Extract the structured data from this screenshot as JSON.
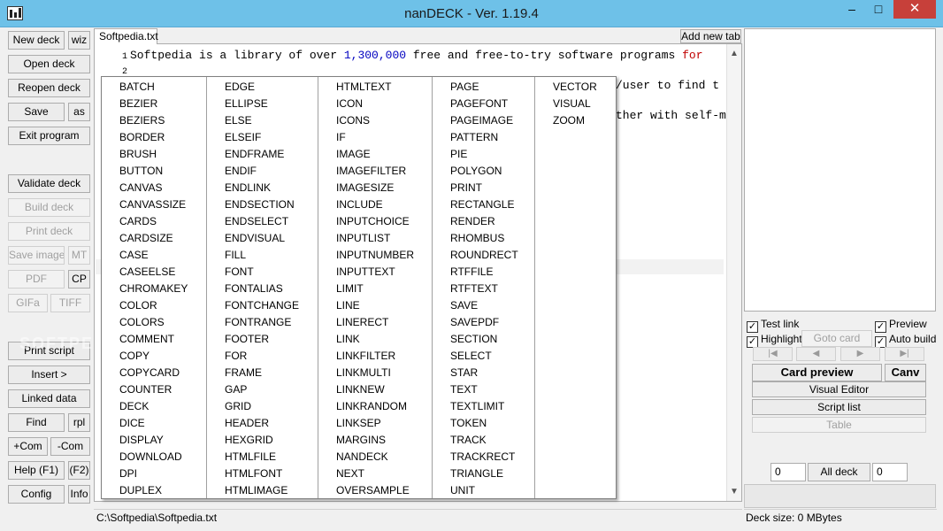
{
  "window": {
    "title": "nanDECK - Ver. 1.19.4"
  },
  "window_controls": {
    "minimize": "–",
    "maximize": "□",
    "close": "✕"
  },
  "left_panel": {
    "new_deck": "New deck",
    "wiz": "wiz",
    "open_deck": "Open deck",
    "reopen_deck": "Reopen deck",
    "save": "Save",
    "save_as": "as",
    "exit": "Exit program",
    "validate": "Validate deck",
    "build": "Build deck",
    "print_deck": "Print deck",
    "save_images": "Save images",
    "mt": "MT",
    "pdf": "PDF",
    "cp": "CP",
    "gifa": "GIFa",
    "tiff": "TIFF",
    "print_script": "Print script",
    "insert": "Insert >",
    "linked_data": "Linked data",
    "find": "Find",
    "rpl": "rpl",
    "plus_com": "+Com",
    "minus_com": "-Com",
    "help": "Help (F1)",
    "f2": "(F2)",
    "config": "Config",
    "info": "Info"
  },
  "editor": {
    "tab_label": "Softpedia.txt",
    "add_tab": "Add new tab",
    "lines": [
      {
        "num": "1",
        "text_a": "Softpedia is a library of over ",
        "num_text": "1,300,000",
        "text_b": " free and free-to-try software programs ",
        "red_text": "for"
      },
      {
        "num": "2",
        "text": ""
      }
    ],
    "partial_3": "/user to find t",
    "partial_4": "ther with self-m"
  },
  "autocomplete": {
    "columns": [
      [
        "BATCH",
        "BEZIER",
        "BEZIERS",
        "BORDER",
        "BRUSH",
        "BUTTON",
        "CANVAS",
        "CANVASSIZE",
        "CARDS",
        "CARDSIZE",
        "CASE",
        "CASEELSE",
        "CHROMAKEY",
        "COLOR",
        "COLORS",
        "COMMENT",
        "COPY",
        "COPYCARD",
        "COUNTER",
        "DECK",
        "DICE",
        "DISPLAY",
        "DOWNLOAD",
        "DPI",
        "DUPLEX"
      ],
      [
        "EDGE",
        "ELLIPSE",
        "ELSE",
        "ELSEIF",
        "ENDFRAME",
        "ENDIF",
        "ENDLINK",
        "ENDSECTION",
        "ENDSELECT",
        "ENDVISUAL",
        "FILL",
        "FONT",
        "FONTALIAS",
        "FONTCHANGE",
        "FONTRANGE",
        "FOOTER",
        "FOR",
        "FRAME",
        "GAP",
        "GRID",
        "HEADER",
        "HEXGRID",
        "HTMLFILE",
        "HTMLFONT",
        "HTMLIMAGE"
      ],
      [
        "HTMLTEXT",
        "ICON",
        "ICONS",
        "IF",
        "IMAGE",
        "IMAGEFILTER",
        "IMAGESIZE",
        "INCLUDE",
        "INPUTCHOICE",
        "INPUTLIST",
        "INPUTNUMBER",
        "INPUTTEXT",
        "LIMIT",
        "LINE",
        "LINERECT",
        "LINK",
        "LINKFILTER",
        "LINKMULTI",
        "LINKNEW",
        "LINKRANDOM",
        "LINKSEP",
        "MARGINS",
        "NANDECK",
        "NEXT",
        "OVERSAMPLE"
      ],
      [
        "PAGE",
        "PAGEFONT",
        "PAGEIMAGE",
        "PATTERN",
        "PIE",
        "POLYGON",
        "PRINT",
        "RECTANGLE",
        "RENDER",
        "RHOMBUS",
        "ROUNDRECT",
        "RTFFILE",
        "RTFTEXT",
        "SAVE",
        "SAVEPDF",
        "SECTION",
        "SELECT",
        "STAR",
        "TEXT",
        "TEXTLIMIT",
        "TOKEN",
        "TRACK",
        "TRACKRECT",
        "TRIANGLE",
        "UNIT"
      ],
      [
        "VECTOR",
        "VISUAL",
        "ZOOM"
      ]
    ]
  },
  "right_panel": {
    "test_link": "Test link",
    "preview": "Preview",
    "highlight": "Highlight",
    "goto_card": "Goto card",
    "auto_build": "Auto build",
    "card_preview": "Card preview",
    "canv": "Canv",
    "visual_editor": "Visual Editor",
    "script_list": "Script list",
    "table": "Table",
    "range_from": "0",
    "all_deck": "All deck",
    "range_to": "0",
    "checks": {
      "test_link": true,
      "preview": true,
      "highlight": true,
      "auto_build": true
    }
  },
  "status": {
    "path": "C:\\Softpedia\\Softpedia.txt",
    "deck_size": "Deck size: 0 MBytes"
  },
  "watermark": "SOFTPEDIA",
  "colors": {
    "titlebar": "#6ec1e8",
    "close": "#c7403a",
    "number_blue": "#0000c0",
    "keyword_red": "#c00000"
  }
}
